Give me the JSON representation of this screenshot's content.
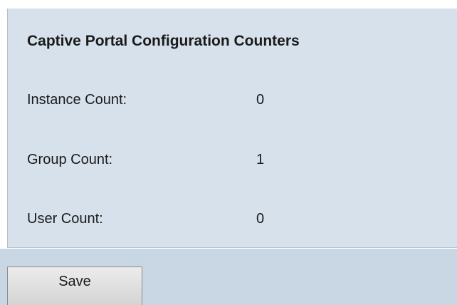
{
  "panel": {
    "title": "Captive Portal Configuration Counters",
    "rows": [
      {
        "label": "Instance Count:",
        "value": "0"
      },
      {
        "label": "Group Count:",
        "value": "1"
      },
      {
        "label": "User Count:",
        "value": "0"
      }
    ]
  },
  "footer": {
    "save_label": "Save"
  }
}
